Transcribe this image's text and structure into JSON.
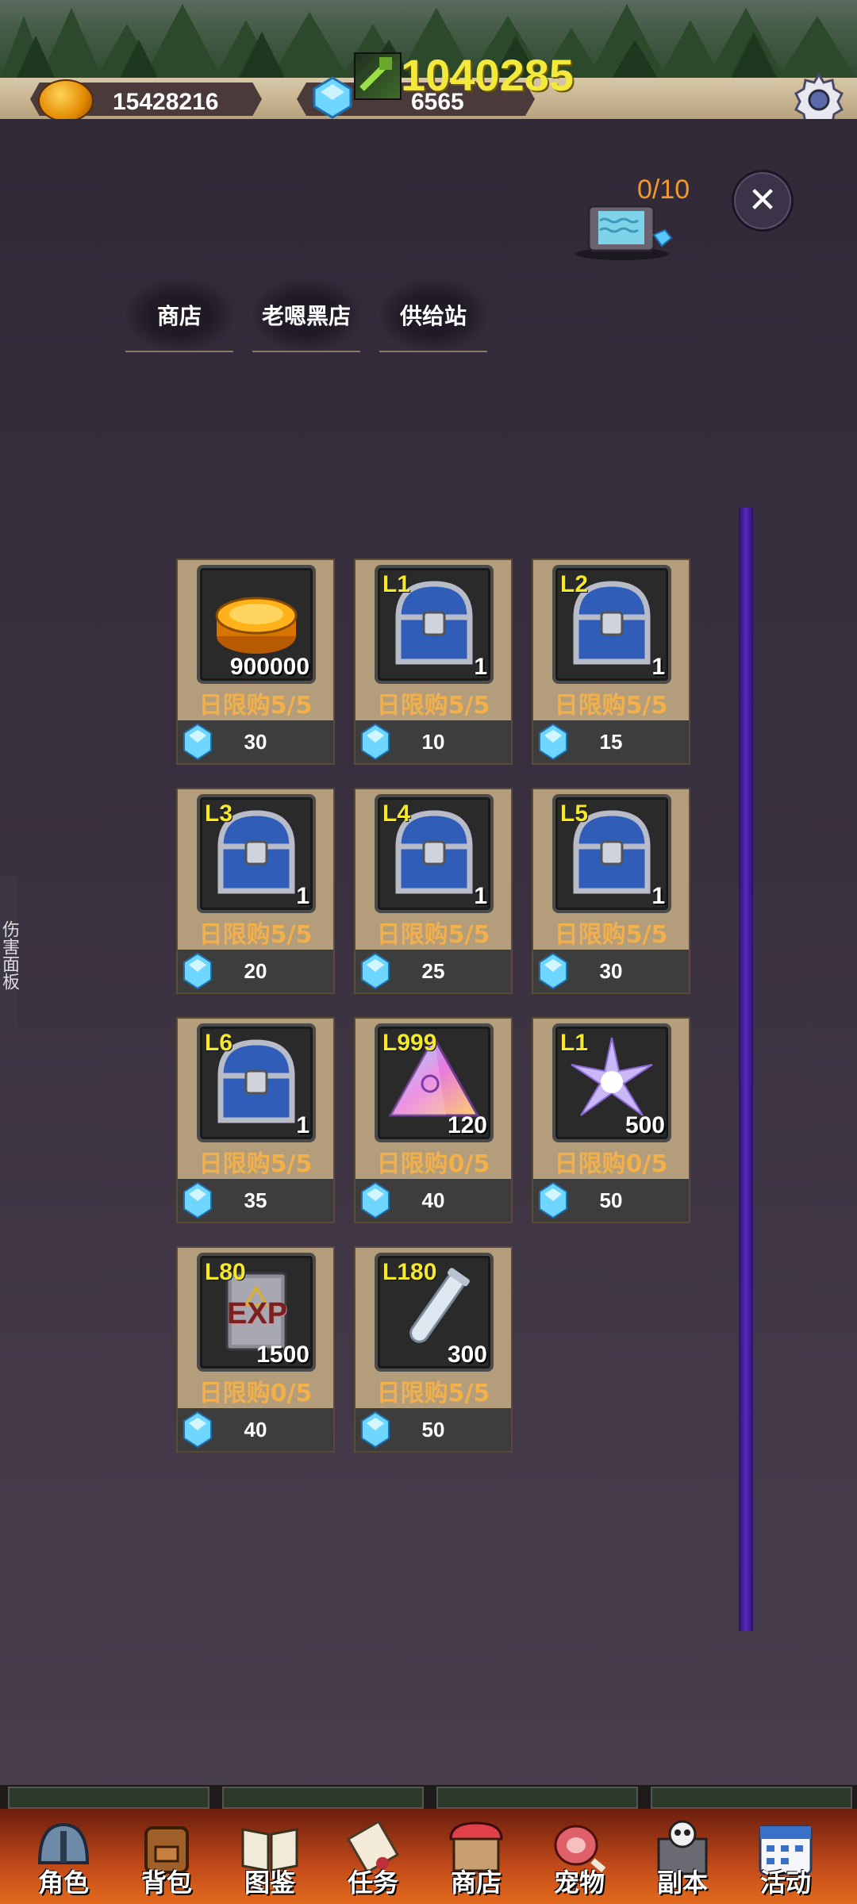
{
  "top": {
    "gold": "15428216",
    "power": "1040285",
    "gems": "6565"
  },
  "tv": {
    "count": "0/10"
  },
  "close_label": "✕",
  "tabs": [
    "商店",
    "老嗯黑店",
    "供给站"
  ],
  "side_panel": "伤害面板",
  "items": [
    {
      "level": "",
      "qty": "900000",
      "limit": "日限购5/5",
      "price": "30",
      "kind": "coin"
    },
    {
      "level": "L1",
      "qty": "1",
      "limit": "日限购5/5",
      "price": "10",
      "kind": "chest"
    },
    {
      "level": "L2",
      "qty": "1",
      "limit": "日限购5/5",
      "price": "15",
      "kind": "chest"
    },
    {
      "level": "L3",
      "qty": "1",
      "limit": "日限购5/5",
      "price": "20",
      "kind": "chest"
    },
    {
      "level": "L4",
      "qty": "1",
      "limit": "日限购5/5",
      "price": "25",
      "kind": "chest"
    },
    {
      "level": "L5",
      "qty": "1",
      "limit": "日限购5/5",
      "price": "30",
      "kind": "chest"
    },
    {
      "level": "L6",
      "qty": "1",
      "limit": "日限购5/5",
      "price": "35",
      "kind": "chest"
    },
    {
      "level": "L999",
      "qty": "120",
      "limit": "日限购0/5",
      "price": "40",
      "kind": "pyramid"
    },
    {
      "level": "L1",
      "qty": "500",
      "limit": "日限购0/5",
      "price": "50",
      "kind": "star"
    },
    {
      "level": "L80",
      "qty": "1500",
      "limit": "日限购0/5",
      "price": "40",
      "kind": "exp"
    },
    {
      "level": "L180",
      "qty": "300",
      "limit": "日限购5/5",
      "price": "50",
      "kind": "tube"
    }
  ],
  "exp_text": "EXP",
  "nav": [
    "角色",
    "背包",
    "图鉴",
    "任务",
    "商店",
    "宠物",
    "副本",
    "活动"
  ]
}
